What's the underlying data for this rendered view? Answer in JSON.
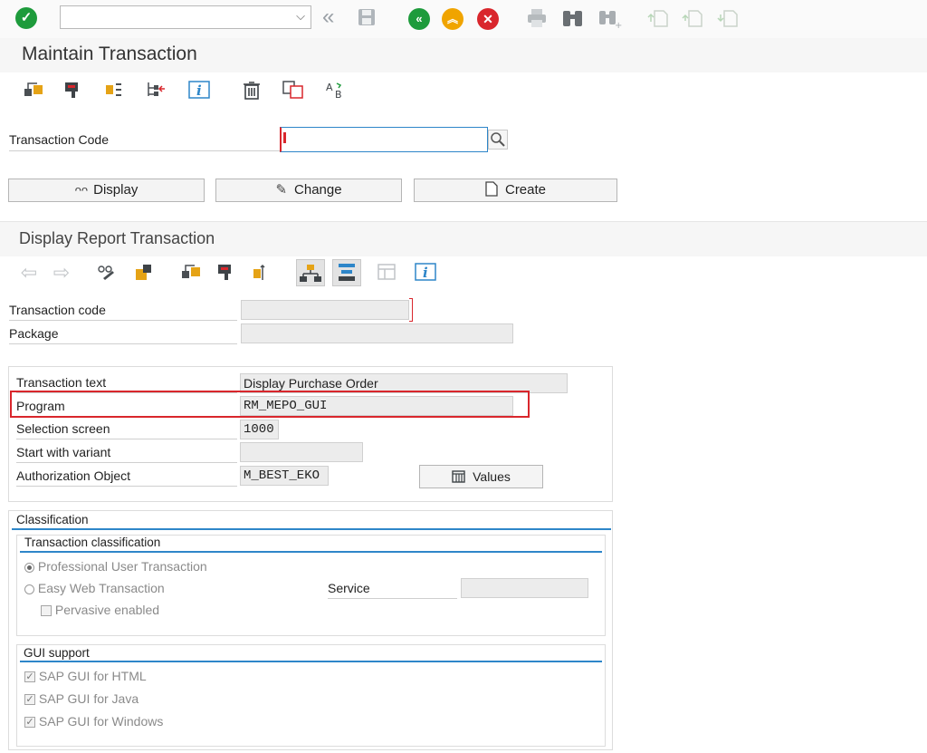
{
  "system_toolbar": {
    "command_field_value": "",
    "icons": [
      "enter-icon",
      "chevron-down-icon",
      "double-left-icon",
      "save-icon",
      "back-icon",
      "exit-icon",
      "cancel-icon",
      "print-icon",
      "find-icon",
      "find-next-icon",
      "first-page-icon",
      "prev-page-icon",
      "next-page-icon"
    ]
  },
  "maintain": {
    "title": "Maintain Transaction",
    "transaction_code_label": "Transaction Code",
    "transaction_code_value": "",
    "display_label": "Display",
    "change_label": "Change",
    "create_label": "Create"
  },
  "display": {
    "title": "Display Report Transaction",
    "transaction_code_label": "Transaction code",
    "transaction_code_value": "",
    "package_label": "Package",
    "package_value": "",
    "transaction_text_label": "Transaction text",
    "transaction_text_value": "Display Purchase Order",
    "program_label": "Program",
    "program_value": "RM_MEPO_GUI",
    "selection_screen_label": "Selection screen",
    "selection_screen_value": "1000",
    "start_variant_label": "Start with variant",
    "start_variant_value": "",
    "auth_object_label": "Authorization Object",
    "auth_object_value": "M_BEST_EKO",
    "values_button": "Values"
  },
  "classification": {
    "title": "Classification",
    "transaction_classification_title": "Transaction classification",
    "professional_label": "Professional User Transaction",
    "easy_web_label": "Easy Web Transaction",
    "pervasive_label": "Pervasive enabled",
    "service_label": "Service",
    "service_value": "",
    "gui_support_title": "GUI support",
    "gui_html_label": "SAP GUI for HTML",
    "gui_java_label": "SAP GUI for Java",
    "gui_windows_label": "SAP GUI for Windows"
  },
  "colors": {
    "highlight_box": "#d9262c",
    "section_line": "#2e86c9",
    "green": "#1e9b3c",
    "orange": "#f0a400",
    "red": "#d9262c"
  }
}
